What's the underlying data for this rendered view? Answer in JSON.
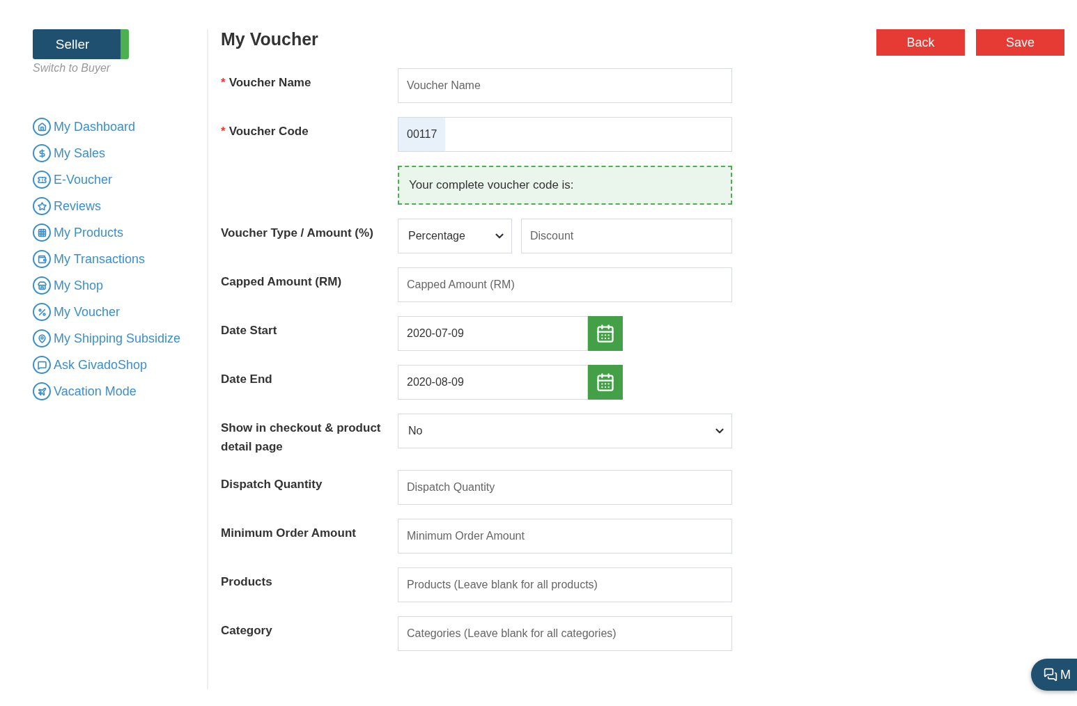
{
  "role_switch": {
    "label": "Seller",
    "on": true,
    "hint": "Switch to Buyer"
  },
  "sidebar": {
    "items": [
      {
        "label": "My Dashboard"
      },
      {
        "label": "My Sales"
      },
      {
        "label": "E-Voucher"
      },
      {
        "label": "Reviews"
      },
      {
        "label": "My Products"
      },
      {
        "label": "My Transactions"
      },
      {
        "label": "My Shop"
      },
      {
        "label": "My Voucher"
      },
      {
        "label": "My Shipping Subsidize"
      },
      {
        "label": "Ask GivadoShop"
      },
      {
        "label": "Vacation Mode"
      }
    ]
  },
  "page": {
    "title": "My Voucher",
    "required_symbol": "*"
  },
  "buttons": [
    "Back",
    "Save"
  ],
  "form": [
    {
      "kind": "text",
      "label": "Voucher Name",
      "required": true,
      "placeholder": "Voucher Name"
    },
    {
      "kind": "code",
      "label": "Voucher Code",
      "required": true,
      "prefix": "00117",
      "note": "Your complete voucher code is:"
    },
    {
      "kind": "select_pair",
      "label": "Voucher Type / Amount (%)",
      "required": false,
      "value": "Percentage",
      "placeholder": "Discount"
    },
    {
      "kind": "text",
      "label": "Capped Amount (RM)",
      "required": false,
      "placeholder": "Capped Amount (RM)"
    },
    {
      "kind": "date",
      "label": "Date Start",
      "required": false,
      "value": "2020-07-09"
    },
    {
      "kind": "date",
      "label": "Date End",
      "required": false,
      "value": "2020-08-09"
    },
    {
      "kind": "select",
      "label": "Show in checkout & product detail page",
      "required": false,
      "value": "No"
    },
    {
      "kind": "text",
      "label": "Dispatch Quantity",
      "required": false,
      "placeholder": "Dispatch Quantity"
    },
    {
      "kind": "text",
      "label": "Minimum Order Amount",
      "required": false,
      "placeholder": "Minimum Order Amount"
    },
    {
      "kind": "text",
      "label": "Products",
      "required": false,
      "placeholder": "Products (Leave blank for all products)"
    },
    {
      "kind": "text",
      "label": "Category",
      "required": false,
      "placeholder": "Categories (Leave blank for all categories)"
    }
  ],
  "chat_button": {
    "label": "M"
  }
}
